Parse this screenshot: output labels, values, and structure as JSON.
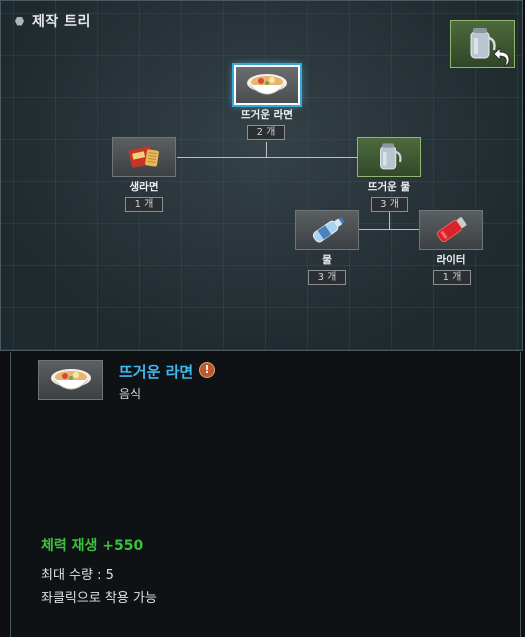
{
  "tree": {
    "title": "제작 트리",
    "nodes": {
      "hot_ramen": {
        "label": "뜨거운 라면",
        "count": "2 개",
        "icon": "ramen-bowl"
      },
      "raw_ramen": {
        "label": "생라면",
        "count": "1 개",
        "icon": "ramen-pack"
      },
      "hot_water": {
        "label": "뜨거운 물",
        "count": "3 개",
        "icon": "kettle"
      },
      "water": {
        "label": "물",
        "count": "3 개",
        "icon": "water-bottle"
      },
      "lighter": {
        "label": "라이터",
        "count": "1 개",
        "icon": "lighter"
      }
    },
    "undo_icon": "undo-arrow"
  },
  "detail": {
    "name": "뜨거운 라면",
    "category": "음식",
    "warning_glyph": "!",
    "stat": "체력 재생 +550",
    "max_qty": "최대 수량 : 5",
    "hint": "좌클릭으로 착용 가능"
  },
  "colors": {
    "accent_name": "#41b7ee",
    "stat_green": "#3cc13c",
    "node_green_border": "#8fb86c",
    "selected_glow": "#3aa7d6"
  }
}
